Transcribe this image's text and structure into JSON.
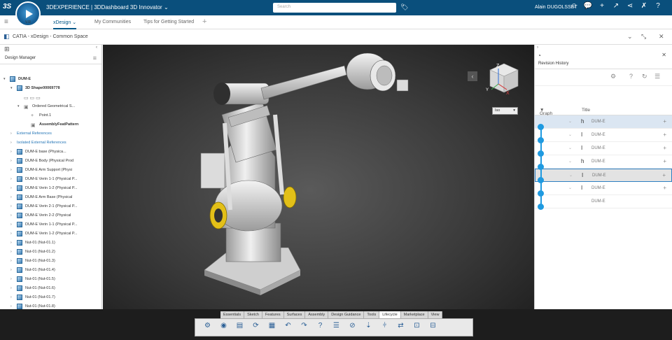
{
  "topbar": {
    "logo": "3S",
    "compass_version": "V.R",
    "title": "3DEXPERIENCE | 3DDashboard 3D Innovator",
    "title_caret": "⌄",
    "search_placeholder": "Search",
    "user": "Alain DUGOLSSET"
  },
  "tabs": {
    "items": [
      "xDesign",
      "My Communities",
      "Tips for Getting Started"
    ],
    "active": "xDesign",
    "caret": "⌄",
    "add": "+"
  },
  "context": {
    "title": "CATIA - xDesign - Common Space"
  },
  "left_panel": {
    "header": "Design Manager",
    "tree": [
      {
        "label": "DUM-E",
        "depth": 0,
        "arrow": "▾",
        "bold": true,
        "icon": "cube"
      },
      {
        "label": "3D Shape00069778",
        "depth": 1,
        "arrow": "▾",
        "bold": true,
        "icon": "cube"
      },
      {
        "label": "",
        "depth": 2,
        "arrow": "",
        "icon": "tool-icons"
      },
      {
        "label": "Ordered Geometrical S...",
        "depth": 2,
        "arrow": "▾",
        "icon": "geoset"
      },
      {
        "label": "Point.1",
        "depth": 3,
        "arrow": "",
        "icon": "point"
      },
      {
        "label": "AssemblyFeatPattern",
        "depth": 3,
        "arrow": "",
        "bold": true,
        "icon": "pattern"
      },
      {
        "label": "External References",
        "depth": 1,
        "arrow": "›",
        "link": true,
        "icon": ""
      },
      {
        "label": "Isolated External References",
        "depth": 1,
        "arrow": "›",
        "link": true,
        "icon": ""
      },
      {
        "label": "DUM-E base (Physica...",
        "depth": 1,
        "arrow": "›",
        "icon": "cube"
      },
      {
        "label": "DUM-E Body (Physical Prod",
        "depth": 1,
        "arrow": "›",
        "icon": "cube"
      },
      {
        "label": "DUM-E Arm Support (Physi",
        "depth": 1,
        "arrow": "›",
        "icon": "cube"
      },
      {
        "label": "DUM-E Verin 1-1 (Physical P...",
        "depth": 1,
        "arrow": "›",
        "icon": "cube"
      },
      {
        "label": "DUM-E Verin 1-2 (Physical P...",
        "depth": 1,
        "arrow": "›",
        "icon": "cube"
      },
      {
        "label": "DUM-E Arm Base (Physical",
        "depth": 1,
        "arrow": "›",
        "icon": "cube"
      },
      {
        "label": "DUM-E Verin 2-1 (Physical P...",
        "depth": 1,
        "arrow": "›",
        "icon": "cube"
      },
      {
        "label": "DUM-E Verin 2-2 (Physical",
        "depth": 1,
        "arrow": "›",
        "icon": "cube"
      },
      {
        "label": "DUM-E Verin 1-1 (Physical P...",
        "depth": 1,
        "arrow": "›",
        "icon": "cube"
      },
      {
        "label": "DUM-E Verin 1-2 (Physical P...",
        "depth": 1,
        "arrow": "›",
        "icon": "cube"
      },
      {
        "label": "Nut-01 (Nut-01.1)",
        "depth": 1,
        "arrow": "›",
        "icon": "cube"
      },
      {
        "label": "Nut-01 (Nut-01.2)",
        "depth": 1,
        "arrow": "›",
        "icon": "cube"
      },
      {
        "label": "Nut-01 (Nut-01.3)",
        "depth": 1,
        "arrow": "›",
        "icon": "cube"
      },
      {
        "label": "Nut-01 (Nut-01.4)",
        "depth": 1,
        "arrow": "›",
        "icon": "cube"
      },
      {
        "label": "Nut-01 (Nut-01.5)",
        "depth": 1,
        "arrow": "›",
        "icon": "cube"
      },
      {
        "label": "Nut-01 (Nut-01.6)",
        "depth": 1,
        "arrow": "›",
        "icon": "cube"
      },
      {
        "label": "Nut-01 (Nut-01.7)",
        "depth": 1,
        "arrow": "›",
        "icon": "cube"
      },
      {
        "label": "Nut-01 (Nut-01.8)",
        "depth": 1,
        "arrow": "›",
        "icon": "cube"
      }
    ]
  },
  "viewport": {
    "view_selector": "Iso",
    "axis_labels": {
      "z": "Z",
      "y": "Y",
      "x": "X"
    }
  },
  "right_panel": {
    "title": "Revision History",
    "columns": {
      "graph": "Graph",
      "title": "Title"
    },
    "revisions": [
      {
        "label": "DUM-E",
        "icon": "h",
        "selected": "primary"
      },
      {
        "label": "DUM-E",
        "icon": "i",
        "selected": ""
      },
      {
        "label": "DUM-E",
        "icon": "i",
        "selected": ""
      },
      {
        "label": "DUM-E",
        "icon": "h",
        "selected": ""
      },
      {
        "label": "DUM-E",
        "icon": "i",
        "selected": "secondary"
      },
      {
        "label": "DUM-E",
        "icon": "i",
        "selected": ""
      },
      {
        "label": "DUM-E",
        "icon": "",
        "selected": ""
      }
    ]
  },
  "action_bar": {
    "tabs": [
      "Essentials",
      "Sketch",
      "Features",
      "Surfaces",
      "Assembly",
      "Design Guidance",
      "Tools",
      "Lifecycle",
      "Marketplace",
      "View"
    ],
    "active": "Lifecycle"
  },
  "colors": {
    "topbar": "#0a4f7c",
    "accent": "#1f9ae0",
    "selected_row": "#dbe6f2"
  }
}
